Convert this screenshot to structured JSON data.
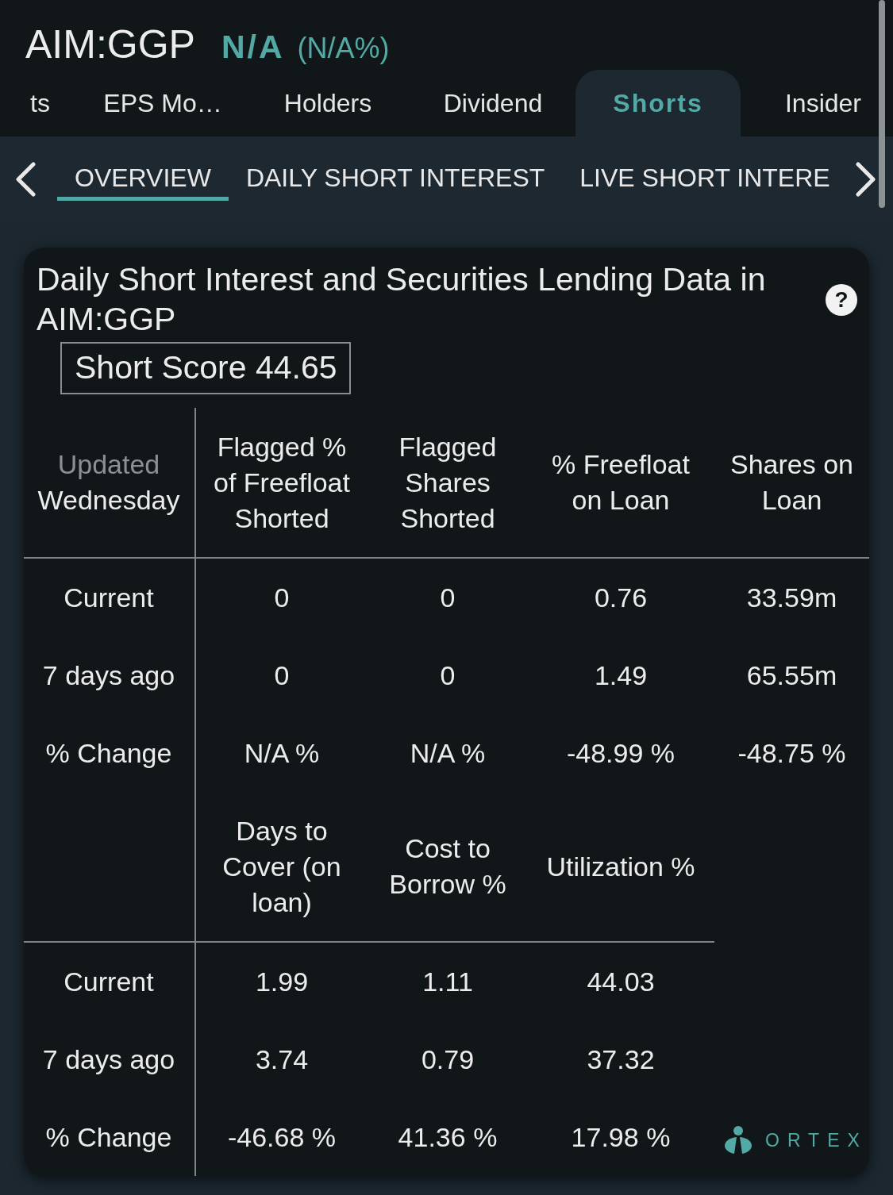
{
  "header": {
    "symbol": "AIM:GGP",
    "price": "N/A",
    "change": "(N/A%)"
  },
  "tabs": [
    {
      "label": "ts",
      "selected": false
    },
    {
      "label": "EPS Mo…",
      "selected": false
    },
    {
      "label": "Holders",
      "selected": false
    },
    {
      "label": "Dividend",
      "selected": false
    },
    {
      "label": "Shorts",
      "selected": true
    },
    {
      "label": "Insider",
      "selected": false
    }
  ],
  "subtabs": [
    {
      "label": "OVERVIEW",
      "selected": true
    },
    {
      "label": "DAILY SHORT INTEREST",
      "selected": false
    },
    {
      "label": "LIVE SHORT INTERE",
      "selected": false
    }
  ],
  "card": {
    "title": "Daily Short Interest and Securities Lending Data in AIM:GGP",
    "help": "?",
    "short_score": "Short Score 44.65",
    "sections": [
      {
        "updated_label": "Updated",
        "updated_value": "Wednesday",
        "columns": [
          "Flagged % of Freefloat Shorted",
          "Flagged Shares Shorted",
          "% Freefloat on Loan",
          "Shares on Loan"
        ],
        "rows": [
          {
            "label": "Current",
            "values": [
              "0",
              "0",
              "0.76",
              "33.59m"
            ]
          },
          {
            "label": "7 days ago",
            "values": [
              "0",
              "0",
              "1.49",
              "65.55m"
            ]
          },
          {
            "label": "% Change",
            "values": [
              "N/A %",
              "N/A %",
              "-48.99 %",
              "-48.75 %"
            ]
          }
        ]
      },
      {
        "columns": [
          "Days to Cover (on loan)",
          "Cost to Borrow %",
          "Utilization %"
        ],
        "rows": [
          {
            "label": "Current",
            "values": [
              "1.99",
              "1.11",
              "44.03"
            ]
          },
          {
            "label": "7 days ago",
            "values": [
              "3.74",
              "0.79",
              "37.32"
            ]
          },
          {
            "label": "% Change",
            "values": [
              "-46.68 %",
              "41.36 %",
              "17.98 %"
            ]
          }
        ]
      }
    ],
    "logo": "ORTEX"
  }
}
